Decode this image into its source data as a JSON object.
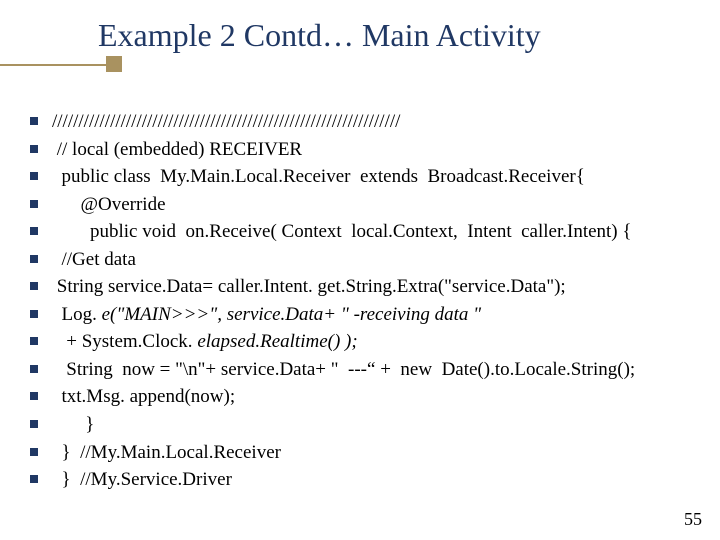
{
  "title": "Example 2 Contd… Main Activity",
  "page_number": "55",
  "bullets": [
    {
      "html": "//////////////////////////////////////////////////////////////////"
    },
    {
      "html": " // local (embedded) RECEIVER"
    },
    {
      "html": "  public class  My.Main.Local.Receiver  extends  Broadcast.Receiver{"
    },
    {
      "html": "      @Override"
    },
    {
      "html": "        public void  on.Receive( Context  local.Context,  Intent  caller.Intent) {"
    },
    {
      "html": "  //Get data"
    },
    {
      "html": " String service.Data= caller.Intent. get.String.Extra(\"service.Data\");"
    },
    {
      "html": "  Log. <span class=\"i\">e(\"MAIN&gt;&gt;&gt;\", service.Data+ \" -receiving data \"</span>"
    },
    {
      "html": "   + System.Clock. <span class=\"i\">elapsed.Realtime() );</span>"
    },
    {
      "html": "   String  now = \"\\n\"+ service.Data+ \"  ---“ +  new  Date().to.Locale.String();"
    },
    {
      "html": "  txt.Msg. append(now);"
    },
    {
      "html": "       }"
    },
    {
      "html": "  }  //My.Main.Local.Receiver"
    },
    {
      "html": "  }  //My.Service.Driver"
    }
  ]
}
